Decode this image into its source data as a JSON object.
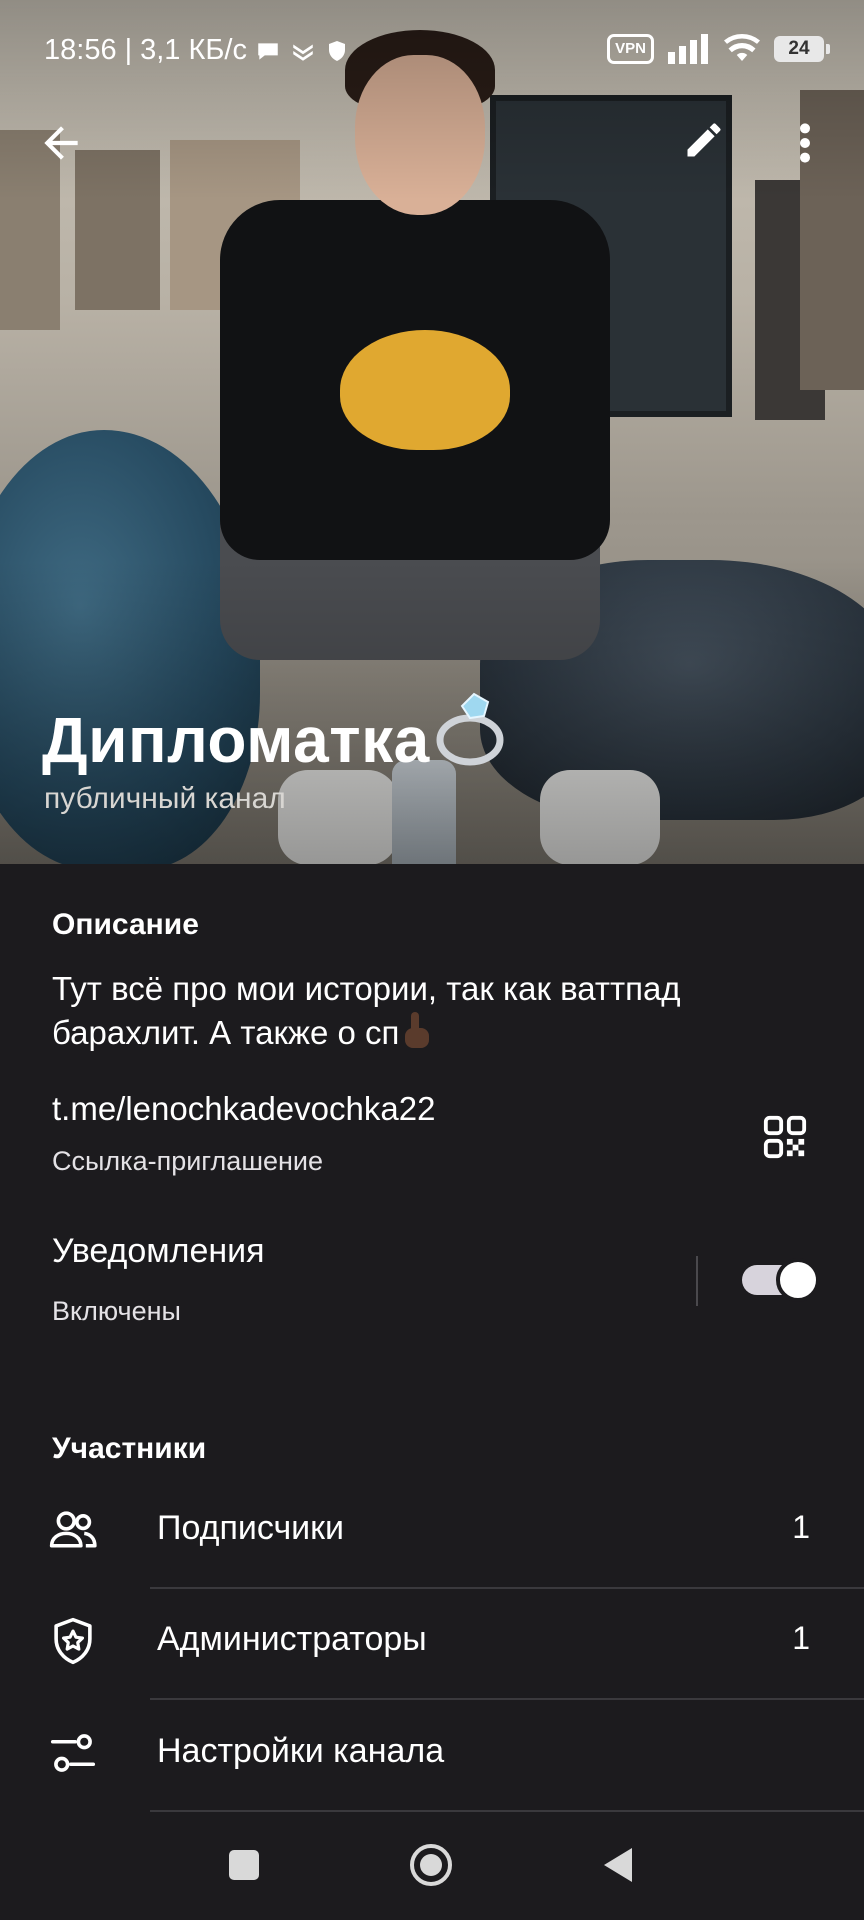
{
  "status_bar": {
    "time": "18:56",
    "speed": "3,1 КБ/с",
    "vpn_label": "VPN",
    "battery_level": "24"
  },
  "app_bar": {
    "back_icon": "arrow-left-icon",
    "edit_icon": "pencil-icon",
    "more_icon": "more-vertical-icon"
  },
  "channel": {
    "title": "Дипломатка",
    "title_emoji": "ring-icon",
    "subtitle": "публичный канал"
  },
  "info": {
    "description_heading": "Описание",
    "description_text": "Тут всё про мои истории, так как ваттпад барахлит. А также о сп",
    "description_emoji": "pointing-up-icon",
    "link": "t.me/lenochkadevochka22",
    "link_caption": "Ссылка-приглашение",
    "qr_icon": "qr-code-icon"
  },
  "notifications": {
    "title": "Уведомления",
    "state": "Включены",
    "enabled": true
  },
  "participants": {
    "heading": "Участники",
    "items": [
      {
        "icon": "users-icon",
        "label": "Подписчики",
        "count": "1"
      },
      {
        "icon": "shield-star-icon",
        "label": "Администраторы",
        "count": "1"
      },
      {
        "icon": "sliders-icon",
        "label": "Настройки канала"
      }
    ]
  },
  "nav_bar": {
    "recents_icon": "square-icon",
    "home_icon": "circle-icon",
    "back_icon": "triangle-back-icon"
  },
  "colors": {
    "background": "#1c1b1e",
    "text_primary": "#ffffff",
    "text_secondary": "#e4e2e6",
    "divider": "#3a393d",
    "toggle_track": "#d7d3dc"
  }
}
